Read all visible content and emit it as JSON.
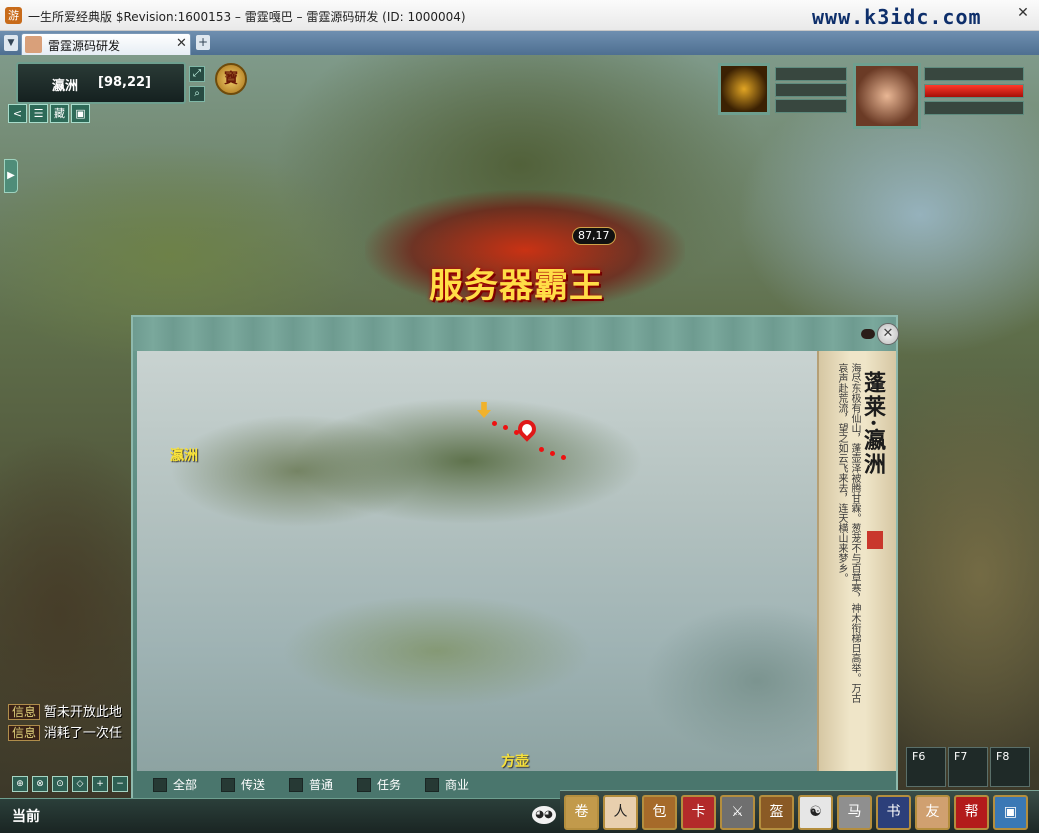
{
  "window": {
    "title": "一生所爱经典版 $Revision:1600153 – 雷霆嘎巴 – 雷霆源码研发 (ID: 1000004)",
    "watermark": "www.k3idc.com",
    "close_glyph": "✕"
  },
  "tabs": [
    {
      "label": "雷霆源码研发",
      "close_glyph": "✕"
    }
  ],
  "tab_new_glyph": "+",
  "minimap": {
    "location": "瀛洲",
    "coords": "[98,22]"
  },
  "treasure_label": "寶",
  "toolbar_buttons": [
    "<",
    "☰",
    "藏",
    "▣"
  ],
  "banner": {
    "title": "服务器霸王",
    "level": "87,17"
  },
  "player": {
    "hp_fraction": 1.0
  },
  "map_dialog": {
    "close_glyph": "✕",
    "location_labels": {
      "left": "瀛洲",
      "bottom": "方壶"
    },
    "scroll": {
      "title": "蓬莱·瀛洲",
      "text": "海尽东极有仙山，蓬壶泽被腾甘霖。葱茏不与百草寒，神木衔梯日高举。万古哀声赴荒流，望之如云飞来去，连天横山来梦乡。"
    },
    "filters": [
      "全部",
      "传送",
      "普通",
      "任务",
      "商业"
    ]
  },
  "chat": [
    {
      "tag": "信息",
      "text": "暂未开放此地"
    },
    {
      "tag": "信息",
      "text": "消耗了一次任"
    }
  ],
  "channel_label": "当前",
  "fkeys": [
    "F6",
    "F7",
    "F8"
  ],
  "skills": [
    {
      "icon": "scroll-icon",
      "color": "#c29a4b",
      "glyph": "卷"
    },
    {
      "icon": "face-icon",
      "color": "#e8cfae",
      "glyph": "人"
    },
    {
      "icon": "bag-icon",
      "color": "#a66a2a",
      "glyph": "包"
    },
    {
      "icon": "card-icon",
      "color": "#b32a2a",
      "glyph": "卡"
    },
    {
      "icon": "swords-icon",
      "color": "#6f6f6f",
      "glyph": "⚔"
    },
    {
      "icon": "helmet-icon",
      "color": "#8a5a25",
      "glyph": "盔"
    },
    {
      "icon": "yin-yang-icon",
      "color": "#e6e6e6",
      "glyph": "☯"
    },
    {
      "icon": "horse-icon",
      "color": "#8f8f8f",
      "glyph": "马"
    },
    {
      "icon": "book-icon",
      "color": "#2c3f7a",
      "glyph": "书"
    },
    {
      "icon": "handshake-icon",
      "color": "#d0a070",
      "glyph": "友"
    },
    {
      "icon": "guild-icon",
      "color": "#b31b1b",
      "glyph": "帮"
    },
    {
      "icon": "computer-icon",
      "color": "#3a78b5",
      "glyph": "▣"
    }
  ],
  "chat_tool_glyphs": [
    "⊕",
    "⊗",
    "⊙",
    "◇",
    "+",
    "−"
  ]
}
